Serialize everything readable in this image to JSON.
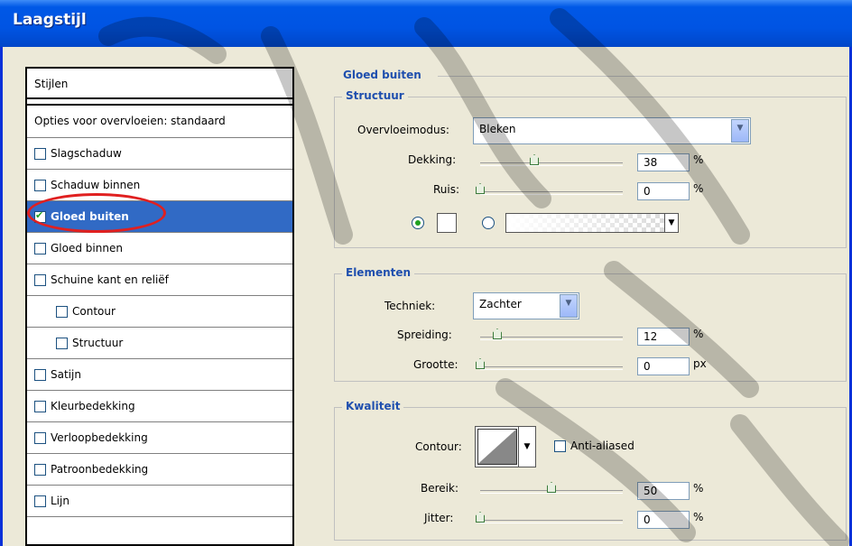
{
  "window": {
    "title": "Laagstijl"
  },
  "styles_list": {
    "header": "Stijlen",
    "blend_options": "Opties voor overvloeien: standaard",
    "items": [
      {
        "label": "Slagschaduw",
        "checked": false,
        "indent": false,
        "selected": false
      },
      {
        "label": "Schaduw binnen",
        "checked": false,
        "indent": false,
        "selected": false
      },
      {
        "label": "Gloed buiten",
        "checked": true,
        "indent": false,
        "selected": true
      },
      {
        "label": "Gloed binnen",
        "checked": false,
        "indent": false,
        "selected": false
      },
      {
        "label": "Schuine kant en reliëf",
        "checked": false,
        "indent": false,
        "selected": false
      },
      {
        "label": "Contour",
        "checked": false,
        "indent": true,
        "selected": false
      },
      {
        "label": "Structuur",
        "checked": false,
        "indent": true,
        "selected": false
      },
      {
        "label": "Satijn",
        "checked": false,
        "indent": false,
        "selected": false
      },
      {
        "label": "Kleurbedekking",
        "checked": false,
        "indent": false,
        "selected": false
      },
      {
        "label": "Verloopbedekking",
        "checked": false,
        "indent": false,
        "selected": false
      },
      {
        "label": "Patroonbedekking",
        "checked": false,
        "indent": false,
        "selected": false
      },
      {
        "label": "Lijn",
        "checked": false,
        "indent": false,
        "selected": false
      }
    ]
  },
  "panel": {
    "title": "Gloed buiten",
    "structure": {
      "title": "Structuur",
      "blend_mode_label": "Overvloeimodus:",
      "blend_mode_value": "Bleken",
      "opacity_label": "Dekking:",
      "opacity_value": "38",
      "opacity_unit": "%",
      "opacity_level": 0.38,
      "noise_label": "Ruis:",
      "noise_value": "0",
      "noise_unit": "%",
      "noise_level": 0
    },
    "elements": {
      "title": "Elementen",
      "technique_label": "Techniek:",
      "technique_value": "Zachter",
      "spread_label": "Spreiding:",
      "spread_value": "12",
      "spread_unit": "%",
      "spread_level": 0.12,
      "size_label": "Grootte:",
      "size_value": "0",
      "size_unit": "px",
      "size_level": 0
    },
    "quality": {
      "title": "Kwaliteit",
      "contour_label": "Contour:",
      "antialias_label": "Anti-aliased",
      "antialias_checked": false,
      "range_label": "Bereik:",
      "range_value": "50",
      "range_unit": "%",
      "range_level": 0.5,
      "jitter_label": "Jitter:",
      "jitter_value": "0",
      "jitter_unit": "%",
      "jitter_level": 0
    }
  },
  "colors": {
    "accent": "#316ac5",
    "section_title": "#1f4fae",
    "highlight_circle": "#e02020",
    "titlebar": "#0054e3"
  }
}
